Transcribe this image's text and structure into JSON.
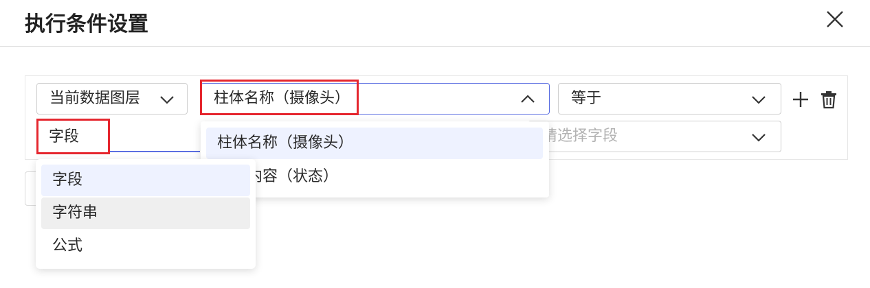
{
  "dialog": {
    "title": "执行条件设置"
  },
  "condition_row": {
    "layer_select": {
      "value": "当前数据图层"
    },
    "field_select": {
      "value": "柱体名称（摄像头）",
      "expanded": true
    },
    "operator_select": {
      "value": "等于"
    },
    "value_type_input": {
      "value": "字段"
    },
    "value_field_select": {
      "placeholder": "请选择字段"
    }
  },
  "field_dropdown": {
    "options": [
      {
        "label": "柱体名称（摄像头）",
        "selected": true
      },
      {
        "label": "柱体内容（状态）",
        "selected": false
      }
    ]
  },
  "type_dropdown": {
    "options": [
      {
        "label": "字段",
        "selected": true
      },
      {
        "label": "字符串",
        "selected": false
      },
      {
        "label": "公式",
        "selected": false
      }
    ]
  },
  "icons": {
    "close": "close-icon",
    "add": "plus-icon",
    "delete": "trash-icon"
  },
  "colors": {
    "accent": "#5b6ee1",
    "highlight": "#e5262e"
  }
}
